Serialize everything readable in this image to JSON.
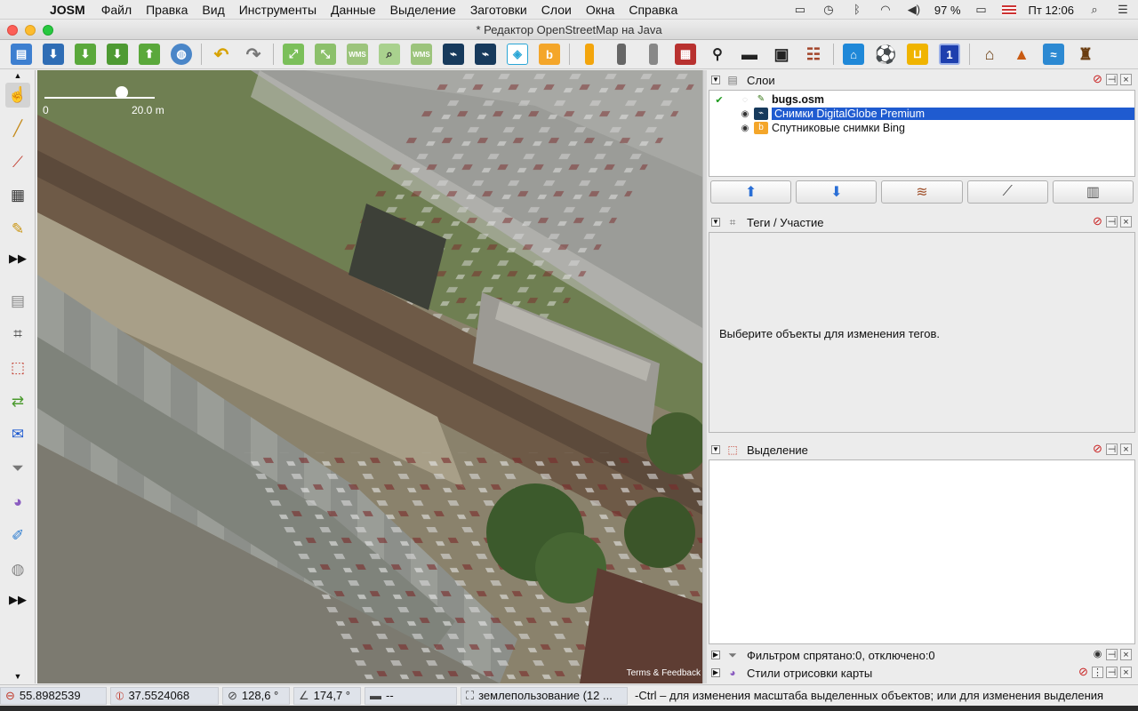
{
  "menubar": {
    "app_name": "JOSM",
    "items": [
      "Файл",
      "Правка",
      "Вид",
      "Инструменты",
      "Данные",
      "Выделение",
      "Заготовки",
      "Слои",
      "Окна",
      "Справка"
    ],
    "battery": "97 %",
    "clock": "Пт 12:06"
  },
  "window": {
    "title": "* Редактор OpenStreetMap на Java"
  },
  "map": {
    "scale_start": "0",
    "scale_end": "20.0 m",
    "attribution": "Terms & Feedback"
  },
  "layers_panel": {
    "title": "Слои",
    "layers": [
      {
        "name": "bugs.osm",
        "bold": true,
        "active": true,
        "selected": false
      },
      {
        "name": "Снимки DigitalGlobe Premium",
        "bold": false,
        "active": false,
        "selected": true
      },
      {
        "name": "Спутниковые снимки Bing",
        "bold": false,
        "active": false,
        "selected": false
      }
    ]
  },
  "tags_panel": {
    "title": "Теги / Участие",
    "hint": "Выберите объекты для изменения тегов."
  },
  "selection_panel": {
    "title": "Выделение"
  },
  "filter_panel": {
    "title": "Фильтром спрятано:0, отключено:0"
  },
  "styles_panel": {
    "title": "Стили отрисовки карты"
  },
  "statusbar": {
    "lat": "55.8982539",
    "lon": "37.5524068",
    "heading": "128,6 °",
    "angle": "174,7 °",
    "distance": "--",
    "object": "землепользование (12 ...",
    "help": "-Ctrl – для изменения масштаба выделенных объектов; или для изменения выделения"
  }
}
